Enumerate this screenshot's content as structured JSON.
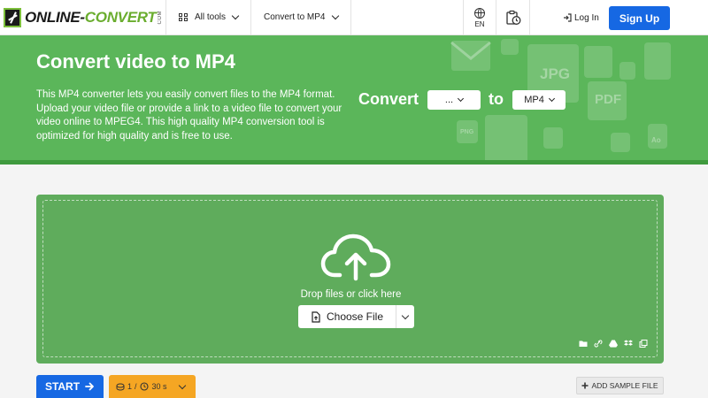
{
  "header": {
    "logo_main": "ONLINE-",
    "logo_accent": "CONVERT",
    "logo_suffix": "COM",
    "all_tools": "All tools",
    "convert_to": "Convert to MP4",
    "lang": "EN",
    "login": "Log In",
    "signup": "Sign Up"
  },
  "hero": {
    "title": "Convert video to MP4",
    "description": "This MP4 converter lets you easily convert files to the MP4 format. Upload your video file or provide a link to a video file to convert your video online to MPEG4. This high quality MP4 conversion tool is optimized for high quality and is free to use.",
    "convert_label": "Convert",
    "from_value": "...",
    "to_label": "to",
    "to_value": "MP4",
    "deco_jpg": "JPG",
    "deco_pdf": "PDF",
    "deco_png": "PNG",
    "deco_ao": "Ao"
  },
  "upload": {
    "drop_text": "Drop files or click here",
    "choose_file": "Choose File"
  },
  "actions": {
    "start": "START",
    "credits_count": "1",
    "credits_sep": "/",
    "credits_time": "30 s",
    "add_sample": "ADD SAMPLE FILE"
  },
  "colors": {
    "hero_green": "#5bb65a",
    "upload_green": "#5fac5c",
    "primary_blue": "#1668e3",
    "credits_orange": "#f5a623"
  }
}
